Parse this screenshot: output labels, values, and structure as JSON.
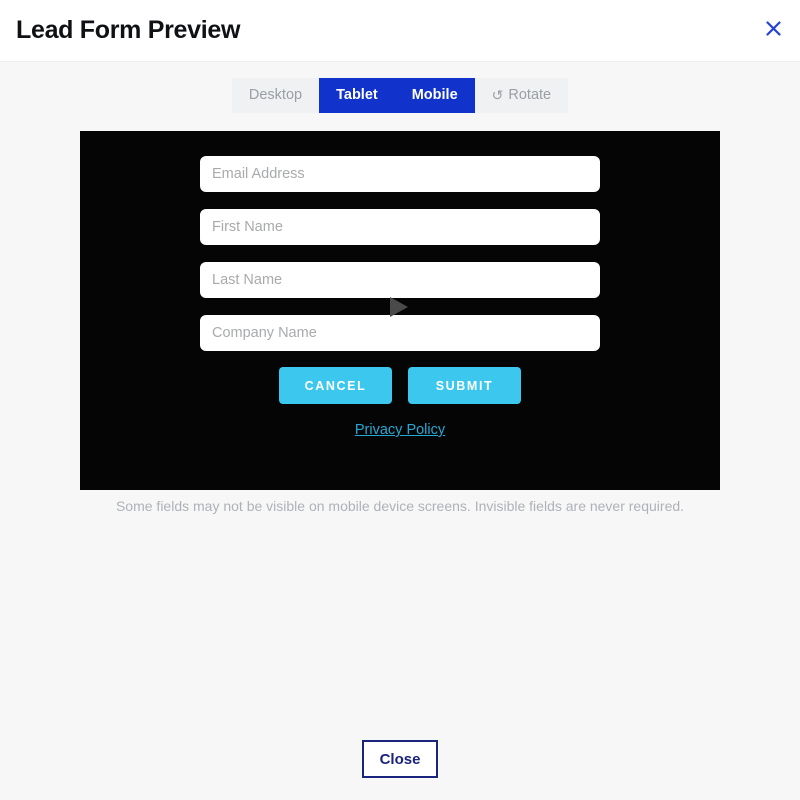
{
  "header": {
    "title": "Lead Form Preview",
    "close_icon": "close-icon",
    "accent_blue": "#2540d8"
  },
  "device_toolbar": {
    "options": [
      {
        "label": "Desktop",
        "active": false
      },
      {
        "label": "Tablet",
        "active": true
      },
      {
        "label": "Mobile",
        "active": true
      }
    ],
    "rotate": {
      "label": "Rotate",
      "icon": "rotate-ccw-icon",
      "glyph": "↺"
    },
    "active_color": "#1133cc",
    "inactive_bg": "#f0f1f3",
    "inactive_text": "#9a9ea5"
  },
  "preview": {
    "background": "#050505",
    "fields": [
      {
        "placeholder": "Email Address",
        "value": "",
        "name": "email-field"
      },
      {
        "placeholder": "First Name",
        "value": "",
        "name": "first-name-field"
      },
      {
        "placeholder": "Last Name",
        "value": "",
        "name": "last-name-field"
      },
      {
        "placeholder": "Company Name",
        "value": "",
        "name": "company-name-field"
      }
    ],
    "buttons": [
      {
        "label": "CANCEL"
      },
      {
        "label": "SUBMIT"
      }
    ],
    "button_color": "#3cc8ee",
    "privacy_link": "Privacy Policy",
    "privacy_link_color": "#27a8d4"
  },
  "footnote": {
    "text": "Some fields may not be visible on mobile device screens. Invisible fields are never required."
  },
  "footer": {
    "close_label": "Close",
    "close_border_color": "#1a237e"
  }
}
